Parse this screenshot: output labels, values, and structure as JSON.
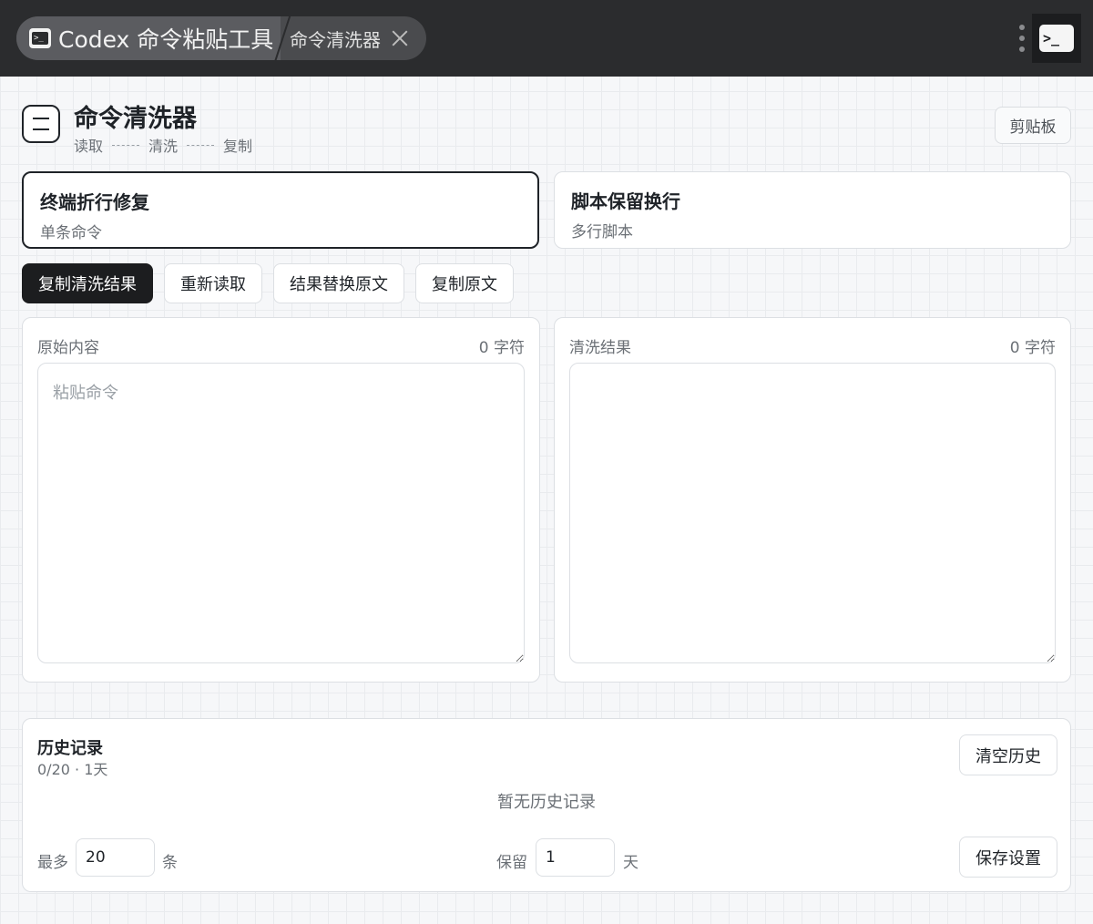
{
  "titlebar": {
    "app_title": "Codex 命令粘贴工具",
    "page_tab": "命令清洗器"
  },
  "header": {
    "title": "命令清洗器",
    "steps": [
      "读取",
      "清洗",
      "复制"
    ],
    "clipboard_label": "剪贴板"
  },
  "modes": [
    {
      "title": "终端折行修复",
      "subtitle": "单条命令",
      "active": true
    },
    {
      "title": "脚本保留换行",
      "subtitle": "多行脚本",
      "active": false
    }
  ],
  "actions": {
    "copy_result": "复制清洗结果",
    "reread": "重新读取",
    "replace_original": "结果替换原文",
    "copy_original": "复制原文"
  },
  "input_panel": {
    "label": "原始内容",
    "count": "0 字符",
    "placeholder": "粘贴命令",
    "value": ""
  },
  "output_panel": {
    "label": "清洗结果",
    "count": "0 字符",
    "value": ""
  },
  "history": {
    "title": "历史记录",
    "meta": "0/20 · 1天",
    "clear_label": "清空历史",
    "empty_text": "暂无历史记录",
    "max_label": "最多",
    "max_value": "20",
    "max_unit": "条",
    "keep_label": "保留",
    "keep_value": "1",
    "keep_unit": "天",
    "save_label": "保存设置"
  },
  "colors": {
    "titlebar_bg": "#2b2c2e",
    "primary_button": "#1c1d1f",
    "border": "#dcdfe3"
  }
}
